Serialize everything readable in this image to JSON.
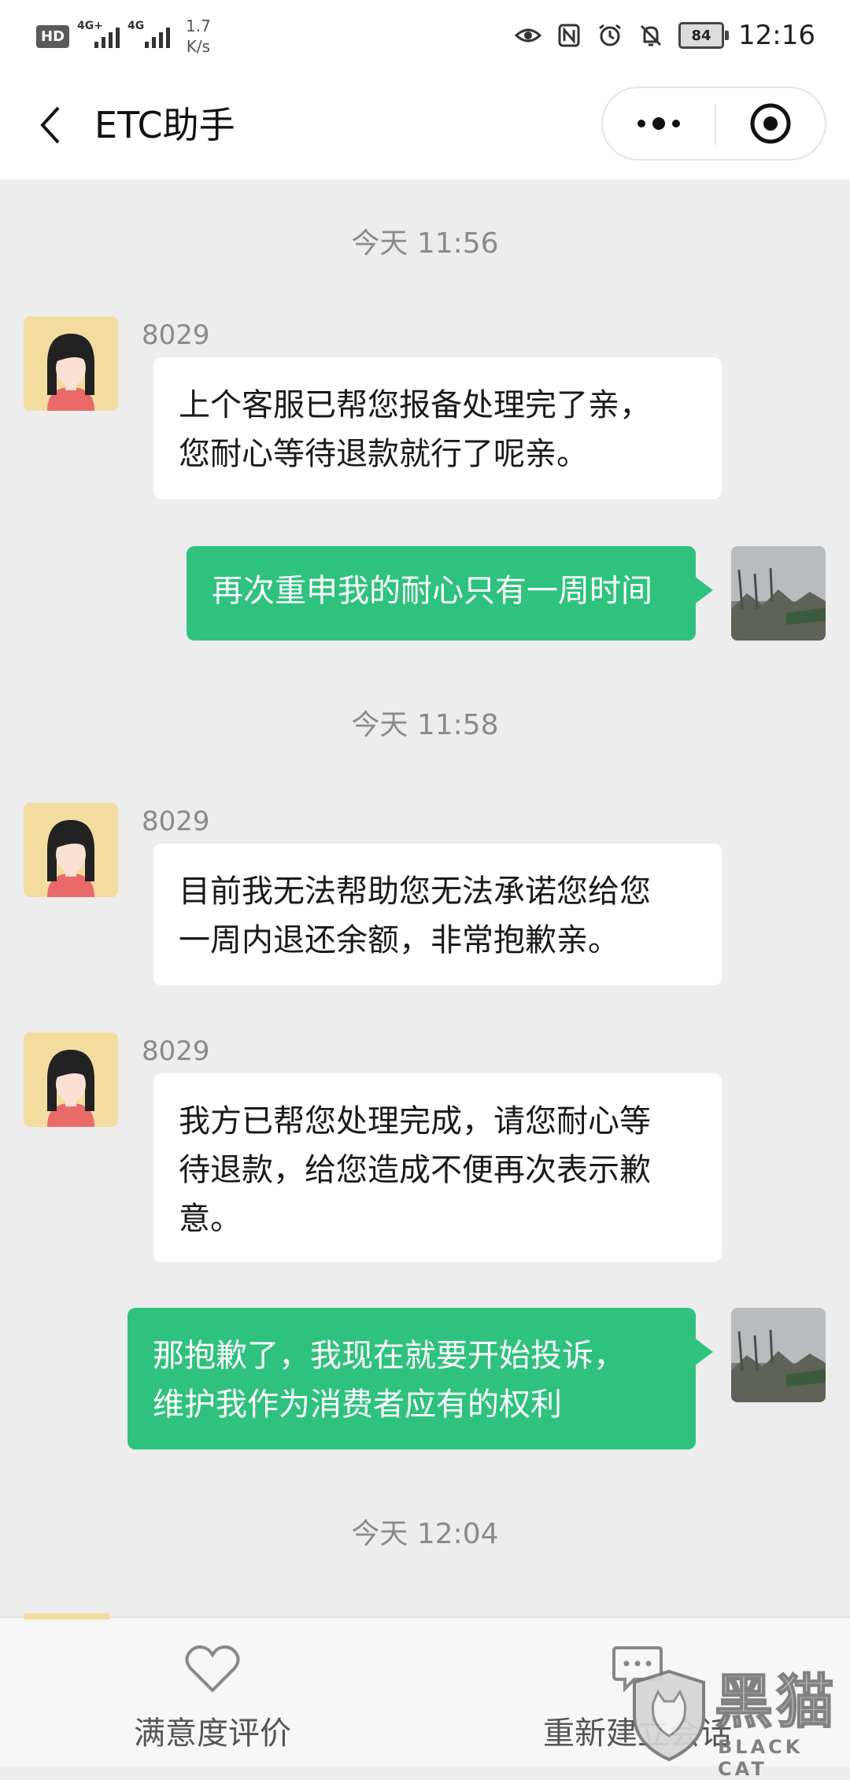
{
  "status_bar": {
    "hd_label": "HD",
    "signal1_label": "4G+",
    "signal2_label": "4G",
    "net_speed_value": "1.7",
    "net_speed_unit": "K/s",
    "battery": "84",
    "time": "12:16"
  },
  "header": {
    "title": "ETC助手"
  },
  "chat": {
    "timestamps": [
      "今天 11:56",
      "今天 11:58",
      "今天 12:04"
    ],
    "messages": [
      {
        "sender": "8029",
        "text": "上个客服已帮您报备处理完了亲，\n您耐心等待退款就行了呢亲。"
      },
      {
        "text": "再次重申我的耐心只有一周时间"
      },
      {
        "sender": "8029",
        "text": "目前我无法帮助您无法承诺您给您\n一周内退还余额，非常抱歉亲。"
      },
      {
        "sender": "8029",
        "text": "我方已帮您处理完成，请您耐心等\n待退款，给您造成不便再次表示歉\n意。"
      },
      {
        "text": "那抱歉了，我现在就要开始投诉，\n维护我作为消费者应有的权利"
      }
    ]
  },
  "bottom_bar": {
    "rate_label": "满意度评价",
    "restart_label": "重新建立会话"
  },
  "watermark": {
    "cn": "黑猫",
    "en": "BLACK CAT"
  },
  "colors": {
    "outgoing_bubble": "#2fc27e",
    "incoming_bubble": "#ffffff",
    "background": "#ededed"
  },
  "icons": [
    "back-arrow-icon",
    "more-dots-icon",
    "close-target-icon",
    "heart-icon",
    "chat-bubble-icon",
    "eye-icon",
    "nfc-icon",
    "alarm-icon",
    "mute-bell-icon"
  ]
}
